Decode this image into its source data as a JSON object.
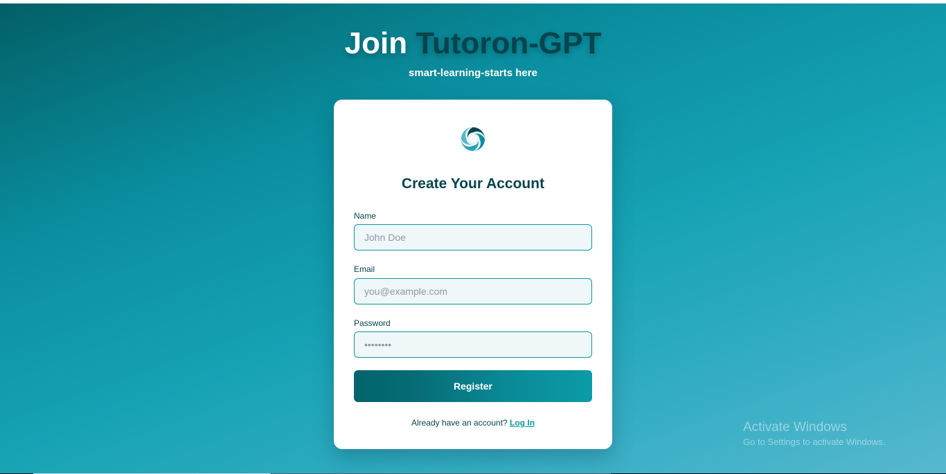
{
  "header": {
    "title_prefix": "Join",
    "title_brand": "Tutoron-GPT",
    "subtitle": "smart-learning-starts here"
  },
  "card": {
    "logo_icon": "swirl-logo-icon",
    "title": "Create Your Account",
    "fields": {
      "name": {
        "label": "Name",
        "placeholder": "John Doe",
        "value": ""
      },
      "email": {
        "label": "Email",
        "placeholder": "you@example.com",
        "value": ""
      },
      "password": {
        "label": "Password",
        "placeholder": "••••••••",
        "value": ""
      }
    },
    "register_label": "Register",
    "login_prompt": "Already have an account?",
    "login_link": "Log In"
  },
  "watermark": {
    "title": "Activate Windows",
    "subtitle": "Go to Settings to activate Windows."
  },
  "colors": {
    "accent": "#0a97a3",
    "brand_dark": "#07444d",
    "button_start": "#03646b",
    "button_end": "#0c9ba8"
  }
}
